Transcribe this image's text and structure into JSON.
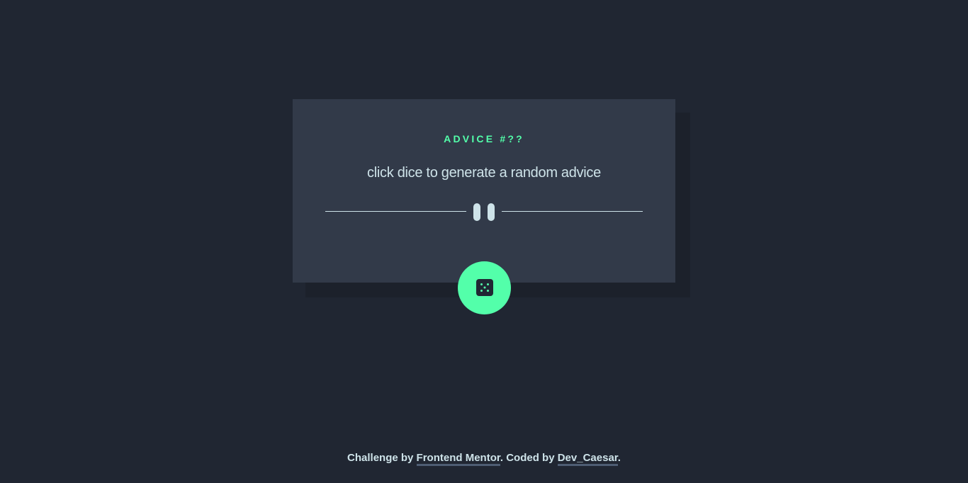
{
  "advice": {
    "id_label": "ADVICE #??",
    "text": "click dice to generate a random advice"
  },
  "button": {
    "icon": "dice-icon"
  },
  "footer": {
    "prefix": "Challenge by",
    "challenge_link": "Frontend Mentor",
    "middle": ". Coded by",
    "author_link": "Dev_Caesar",
    "suffix": "."
  },
  "colors": {
    "background": "#202632",
    "card": "#323a49",
    "accent": "#53ffaa",
    "text": "#cee3e9"
  }
}
